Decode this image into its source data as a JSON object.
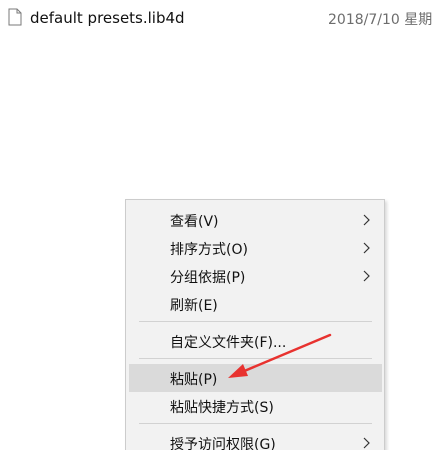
{
  "file_row": {
    "name": "default presets.lib4d",
    "date": "2018/7/10 星期",
    "icon": "document-icon"
  },
  "context_menu": {
    "items": [
      {
        "label": "查看(V)",
        "has_submenu": true,
        "icon": "chevron-right-icon"
      },
      {
        "label": "排序方式(O)",
        "has_submenu": true,
        "icon": "chevron-right-icon"
      },
      {
        "label": "分组依据(P)",
        "has_submenu": true,
        "icon": "chevron-right-icon"
      },
      {
        "label": "刷新(E)",
        "has_submenu": false
      },
      {
        "label": "自定义文件夹(F)...",
        "has_submenu": false
      },
      {
        "label": "粘贴(P)",
        "has_submenu": false,
        "highlighted": true
      },
      {
        "label": "粘贴快捷方式(S)",
        "has_submenu": false
      },
      {
        "label": "授予访问权限(G)",
        "has_submenu": true,
        "icon": "chevron-right-icon"
      }
    ]
  },
  "annotation": {
    "type": "arrow",
    "color": "#e8322f",
    "points_to": "粘贴(P)"
  }
}
